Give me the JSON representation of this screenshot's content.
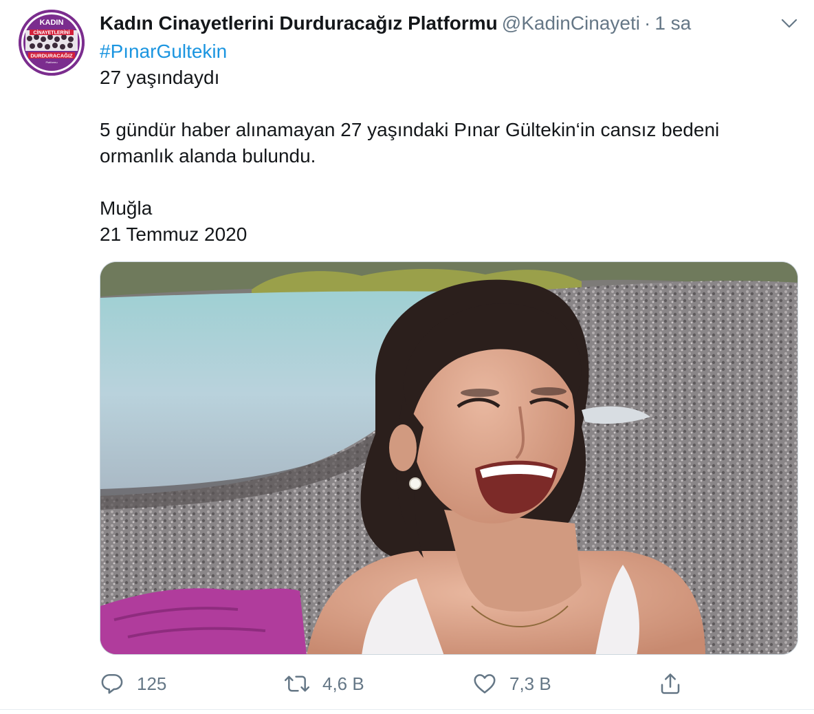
{
  "author": {
    "display_name": "Kadın Cinayetlerini Durduracağız Platformu",
    "handle": "@KadinCinayeti",
    "separator": "·",
    "time": "1 sa",
    "avatar": {
      "line1": "KADIN",
      "line2": "CİNAYETLERİNİ",
      "line3": "DURDURACAĞIZ",
      "line4": "Platformu",
      "bg_color": "#7b2d8e",
      "ring_color": "#ffffff"
    }
  },
  "tweet": {
    "hashtag": "#PınarGultekin",
    "line_age": "27 yaşındaydı",
    "line_news": "5 gündür haber alınamayan 27 yaşındaki Pınar Gültekin‘in cansız bedeni ormanlık alanda bulundu.",
    "line_place": "Muğla",
    "line_date": "21 Temmuz 2020"
  },
  "actions": {
    "reply_count": "125",
    "retweet_count": "4,6 B",
    "like_count": "7,3 B"
  },
  "icons": {
    "caret": "chevron-down-icon",
    "reply": "reply-icon",
    "retweet": "retweet-icon",
    "like": "heart-icon",
    "share": "share-icon"
  },
  "colors": {
    "text": "#14171a",
    "secondary": "#657786",
    "link": "#1b95e0",
    "border": "#e6ecf0"
  }
}
